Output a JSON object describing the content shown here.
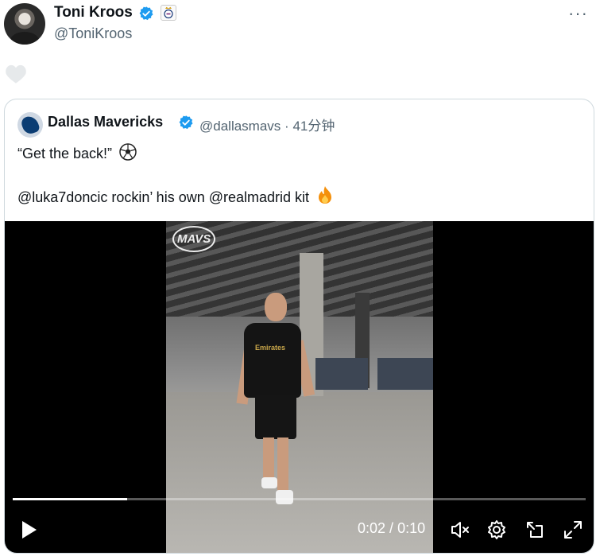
{
  "post": {
    "author_name": "Toni Kroos",
    "author_handle": "@ToniKroos",
    "more_label": "···"
  },
  "quoted": {
    "author_name": "Dallas Mavericks",
    "author_handle": "@dallasmavs",
    "separator": "·",
    "time_ago": "41分钟",
    "line1": "“Get the back!”",
    "line2": "@luka7doncic rockin’ his own @realmadrid kit"
  },
  "video": {
    "current_time": "0:02",
    "duration": "0:10",
    "time_separator": " / ",
    "progress_fraction": 0.2,
    "watermark": "MAVS",
    "jersey_sponsor": "Emirates"
  },
  "colors": {
    "verified_blue": "#1d9bf0",
    "secondary_text": "#536471",
    "border": "#cfd9de"
  },
  "icons": [
    "verified-icon",
    "club-badge-icon",
    "more-icon",
    "heart-icon",
    "soccer-ball-emoji",
    "fire-emoji",
    "play-icon",
    "volume-muted-icon",
    "settings-icon",
    "pip-icon",
    "fullscreen-icon"
  ]
}
